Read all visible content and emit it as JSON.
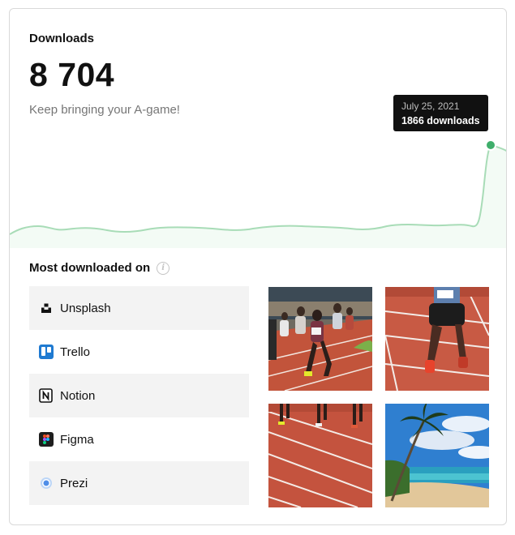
{
  "stats": {
    "title": "Downloads",
    "total": "8 704",
    "subtitle": "Keep bringing your A-game!"
  },
  "tooltip": {
    "date": "July 25, 2021",
    "downloads": "1866 downloads"
  },
  "colors": {
    "line": "#a8dcb7",
    "area": "#f3fbf5",
    "dot": "#3fae6b",
    "shaded_row": "#f3f3f3"
  },
  "section": {
    "title": "Most downloaded on",
    "info_icon": "info-icon"
  },
  "apps": [
    {
      "label": "Unsplash",
      "icon": "unsplash-icon"
    },
    {
      "label": "Trello",
      "icon": "trello-icon"
    },
    {
      "label": "Notion",
      "icon": "notion-icon"
    },
    {
      "label": "Figma",
      "icon": "figma-icon"
    },
    {
      "label": "Prezi",
      "icon": "prezi-icon"
    }
  ],
  "photos": [
    {
      "subject": "runners-on-track"
    },
    {
      "subject": "runner-legs-on-track"
    },
    {
      "subject": "red-running-track-lanes"
    },
    {
      "subject": "tropical-beach-palm"
    }
  ]
}
